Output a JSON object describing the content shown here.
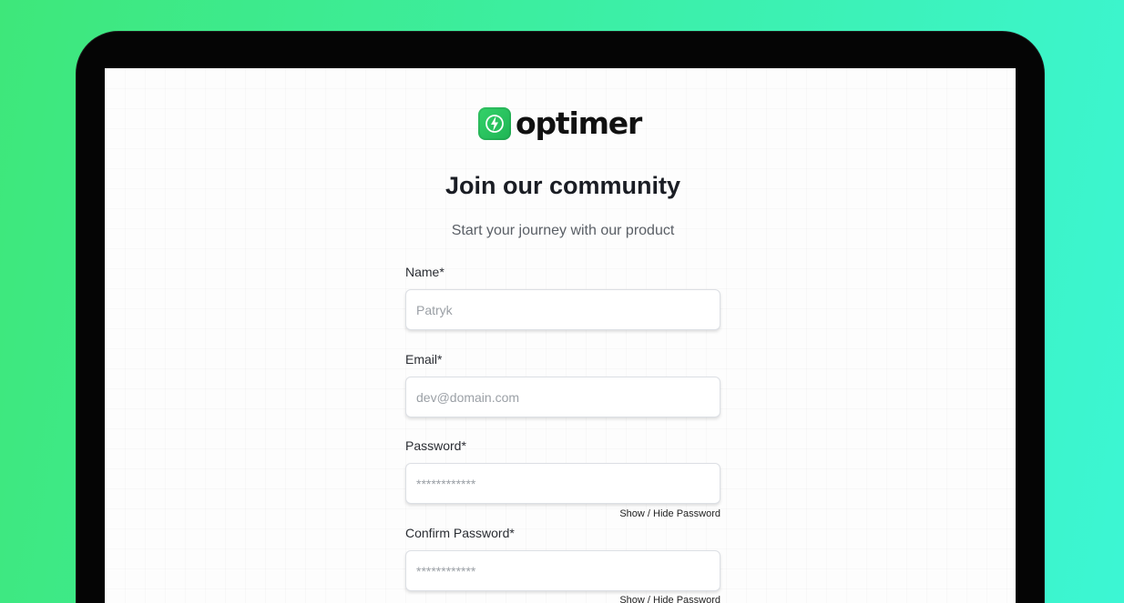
{
  "brand": {
    "name": "optimer",
    "accent_color": "#2ec561",
    "logo_icon": "lightning-bolt-icon"
  },
  "header": {
    "title": "Join our community",
    "subtitle": "Start your journey with our product"
  },
  "form": {
    "name": {
      "label": "Name*",
      "placeholder": "Patryk"
    },
    "email": {
      "label": "Email*",
      "placeholder": "dev@domain.com"
    },
    "password": {
      "label": "Password*",
      "placeholder": "************",
      "toggle_label": "Show / Hide Password"
    },
    "confirm_password": {
      "label": "Confirm Password*",
      "placeholder": "************",
      "toggle_label": "Show / Hide Password"
    }
  }
}
